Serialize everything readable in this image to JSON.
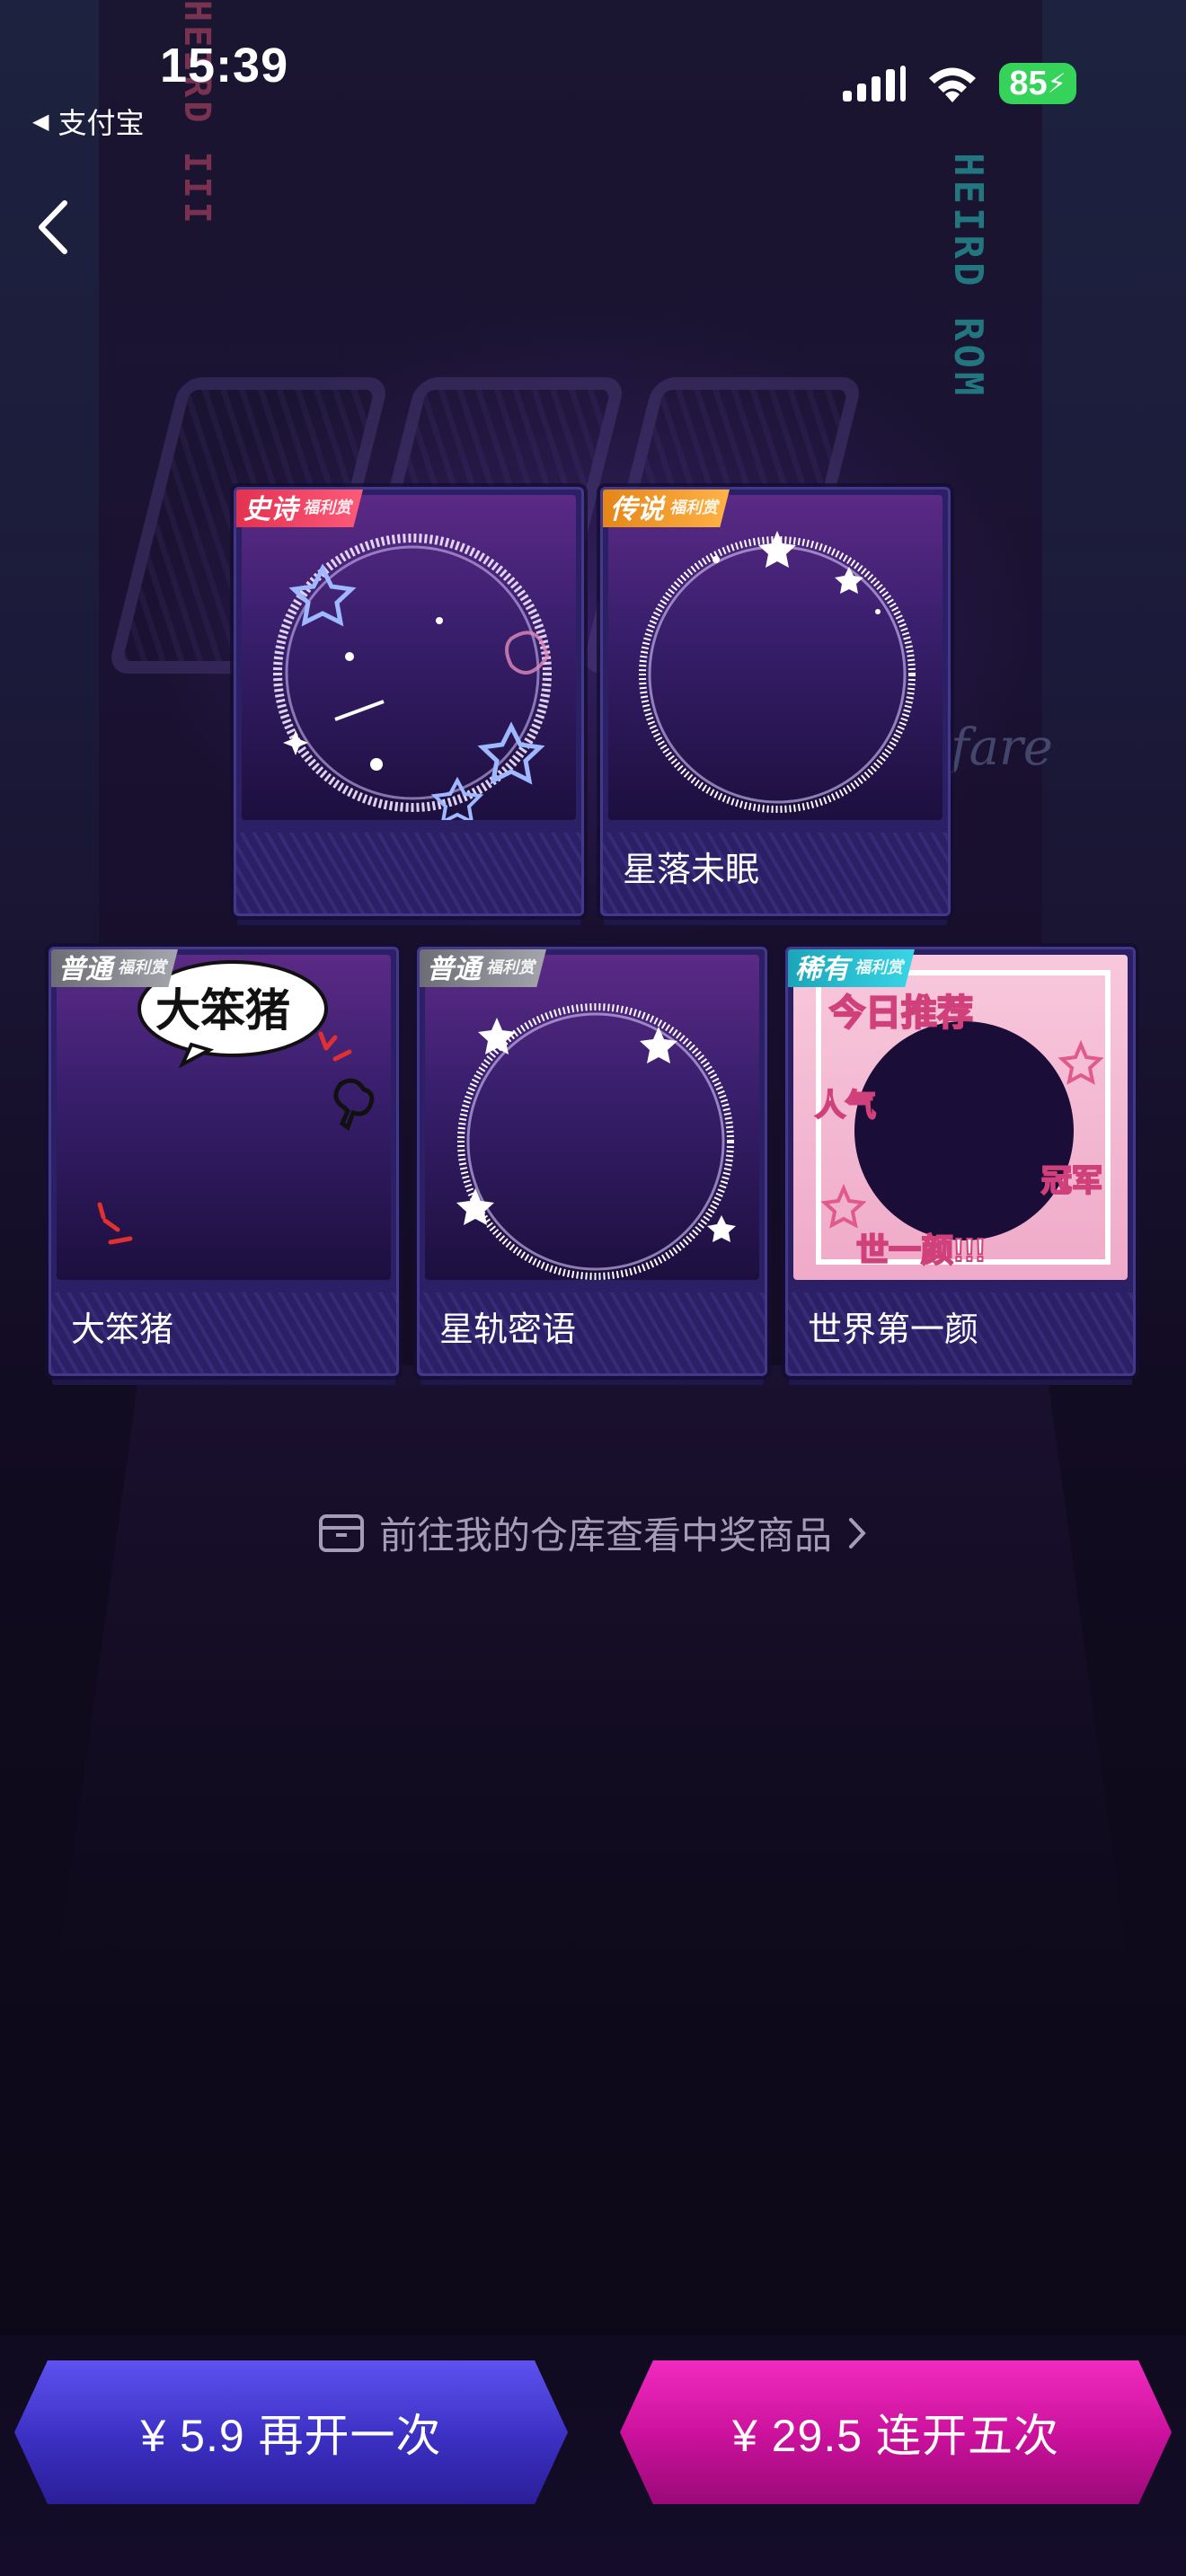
{
  "status_bar": {
    "time": "15:39",
    "back_app": "支付宝",
    "battery": "85"
  },
  "cards": [
    {
      "tag": "史诗",
      "tag_sub": "福利赏",
      "name": ""
    },
    {
      "tag": "传说",
      "tag_sub": "福利赏",
      "name": "星落未眠"
    },
    {
      "tag": "普通",
      "tag_sub": "福利赏",
      "name": "大笨猪",
      "art_text": "大笨猪"
    },
    {
      "tag": "普通",
      "tag_sub": "福利赏",
      "name": "星轨密语"
    },
    {
      "tag": "稀有",
      "tag_sub": "福利赏",
      "name": "世界第一颜",
      "art_text": [
        "今日推荐",
        "人气",
        "冠军",
        "世一颜!!!"
      ]
    }
  ],
  "warehouse_link": "前往我的仓库查看中奖商品",
  "buttons": {
    "again": "¥ 5.9 再开一次",
    "five": "¥ 29.5 连开五次"
  },
  "background": {
    "neon_left": "HEIRD III",
    "neon_right": "HEIRD ROM",
    "script": "lfare"
  },
  "colors": {
    "epic": "#e2314f",
    "legend": "#e48516",
    "normal": "#8a8a94",
    "rare": "#1aa4b8",
    "again_button": "#3b2fc2",
    "five_button": "#c8109a",
    "battery": "#36d35a"
  }
}
